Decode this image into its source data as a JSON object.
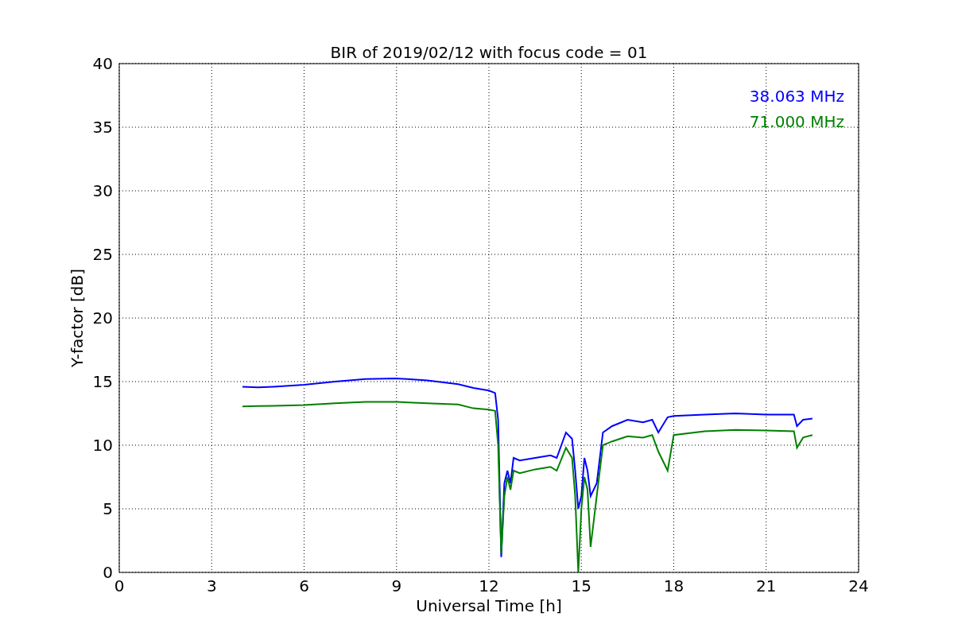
{
  "chart_data": {
    "type": "line",
    "title": "BIR of 2019/02/12 with focus code = 01",
    "xlabel": "Universal Time [h]",
    "ylabel": "Y-factor [dB]",
    "xlim": [
      0,
      24
    ],
    "ylim": [
      0,
      40
    ],
    "grid": true,
    "xticks": [
      0,
      3,
      6,
      9,
      12,
      15,
      18,
      21,
      24
    ],
    "yticks": [
      0,
      5,
      10,
      15,
      20,
      25,
      30,
      35,
      40
    ],
    "x": [
      4,
      4.5,
      5,
      6,
      7,
      8,
      9,
      10,
      11,
      11.5,
      12,
      12.2,
      12.3,
      12.4,
      12.5,
      12.6,
      12.7,
      12.8,
      13,
      13.5,
      14,
      14.2,
      14.5,
      14.7,
      14.8,
      14.9,
      15,
      15.1,
      15.2,
      15.3,
      15.5,
      15.7,
      16,
      16.5,
      17,
      17.3,
      17.5,
      17.8,
      18,
      19,
      20,
      21,
      21.9,
      22,
      22.2,
      22.5
    ],
    "series": [
      {
        "name": "38.063 MHz",
        "color": "#0000ff",
        "values": [
          14.6,
          14.55,
          14.6,
          14.75,
          15.0,
          15.2,
          15.25,
          15.1,
          14.8,
          14.5,
          14.3,
          14.1,
          12,
          1.2,
          7,
          8,
          7,
          9,
          8.8,
          9,
          9.2,
          9,
          11,
          10.5,
          8,
          5,
          6,
          9,
          8,
          6,
          7,
          11,
          11.5,
          12,
          11.8,
          12,
          11,
          12.2,
          12.3,
          12.4,
          12.5,
          12.4,
          12.4,
          11.5,
          12.0,
          12.1
        ]
      },
      {
        "name": "71.000 MHz",
        "color": "#008000",
        "values": [
          13.05,
          13.08,
          13.1,
          13.15,
          13.3,
          13.4,
          13.4,
          13.3,
          13.2,
          12.9,
          12.8,
          12.7,
          10,
          1.5,
          6,
          7.5,
          6.5,
          8,
          7.8,
          8.1,
          8.3,
          8,
          9.8,
          9,
          6,
          0,
          5,
          7.5,
          6.5,
          2,
          6,
          10,
          10.3,
          10.7,
          10.6,
          10.8,
          9.5,
          8,
          10.8,
          11.1,
          11.2,
          11.15,
          11.1,
          9.8,
          10.6,
          10.8
        ]
      }
    ]
  }
}
